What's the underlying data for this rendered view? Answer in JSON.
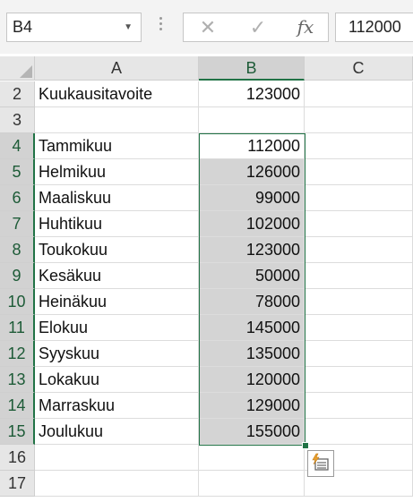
{
  "name_box": {
    "value": "B4"
  },
  "formula_bar": {
    "cancel_icon": "close-icon",
    "enter_icon": "check-icon",
    "fx_label": "fx",
    "value": "112000"
  },
  "columns": [
    "A",
    "B",
    "C"
  ],
  "rows": [
    {
      "num": "2",
      "a": "Kuukausitavoite",
      "b": "123000",
      "c": ""
    },
    {
      "num": "3",
      "a": "",
      "b": "",
      "c": ""
    },
    {
      "num": "4",
      "a": "Tammikuu",
      "b": "112000",
      "c": ""
    },
    {
      "num": "5",
      "a": "Helmikuu",
      "b": "126000",
      "c": ""
    },
    {
      "num": "6",
      "a": "Maaliskuu",
      "b": "99000",
      "c": ""
    },
    {
      "num": "7",
      "a": "Huhtikuu",
      "b": "102000",
      "c": ""
    },
    {
      "num": "8",
      "a": "Toukokuu",
      "b": "123000",
      "c": ""
    },
    {
      "num": "9",
      "a": "Kesäkuu",
      "b": "50000",
      "c": ""
    },
    {
      "num": "10",
      "a": "Heinäkuu",
      "b": "78000",
      "c": ""
    },
    {
      "num": "11",
      "a": "Elokuu",
      "b": "145000",
      "c": ""
    },
    {
      "num": "12",
      "a": "Syyskuu",
      "b": "135000",
      "c": ""
    },
    {
      "num": "13",
      "a": "Lokakuu",
      "b": "120000",
      "c": ""
    },
    {
      "num": "14",
      "a": "Marraskuu",
      "b": "129000",
      "c": ""
    },
    {
      "num": "15",
      "a": "Joulukuu",
      "b": "155000",
      "c": ""
    },
    {
      "num": "16",
      "a": "",
      "b": "",
      "c": ""
    },
    {
      "num": "17",
      "a": "",
      "b": "",
      "c": ""
    }
  ],
  "selection": {
    "active_cell": "B4",
    "range": "B4:B15",
    "accent_color": "#217346",
    "fill_color": "#d4d4d4"
  },
  "quick_analysis": {
    "icon": "quick-analysis-icon"
  }
}
